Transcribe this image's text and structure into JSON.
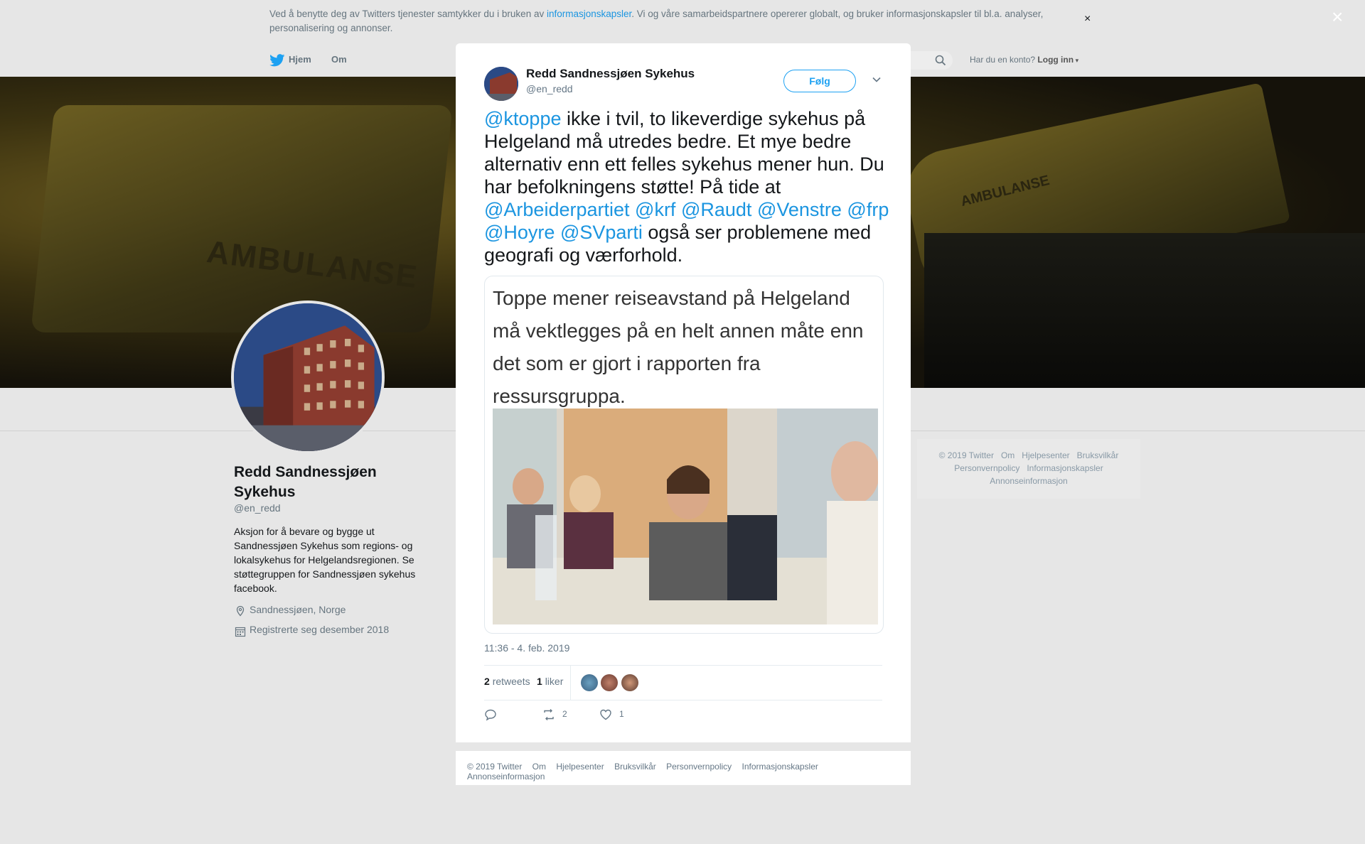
{
  "cookie": {
    "text_before": "Ved å benytte deg av Twitters tjenester samtykker du i bruken av ",
    "link": "informasjonskapsler",
    "text_after": ". Vi og våre samarbeidspartnere opererer globalt, og bruker informasjonskapsler til bl.a. analyser, personalisering og annonser.",
    "close": "×"
  },
  "nav": {
    "home": "Hjem",
    "about": "Om",
    "account_prompt": "Har du en konto?",
    "login": "Logg inn"
  },
  "profile": {
    "name": "Redd Sandnessjøen Sykehus",
    "handle": "@en_redd",
    "bio": "Aksjon for å bevare og bygge ut Sandnessjøen Sykehus som regions- og lokalsykehus for Helgelandsregionen. Se støttegruppen for Sandnessjøen sykehus facebook.",
    "location": "Sandnessjøen, Norge",
    "joined": "Registrerte seg desember 2018"
  },
  "banner": {
    "text_left": "AMBULANSE",
    "text_right": "AMBULANSE"
  },
  "side_footer": {
    "row1": [
      "© 2019 Twitter",
      "Om",
      "Hjelpesenter",
      "Bruksvilkår"
    ],
    "row2": [
      "Personvernpolicy",
      "Informasjonskapsler"
    ],
    "row3": [
      "Annonseinformasjon"
    ]
  },
  "overlay_close": "×",
  "tweet": {
    "author_name": "Redd Sandnessjøen Sykehus",
    "author_handle": "@en_redd",
    "follow_label": "Følg",
    "mention1": "@ktoppe",
    "text_part1": " ikke i tvil, to likeverdige sykehus på Helgeland må utredes bedre. Et mye bedre alternativ enn ett felles sykehus mener hun. Du har befolkningens støtte! På tide at ",
    "mentions": [
      "@Arbeiderpartiet",
      "@krf",
      "@Raudt",
      "@Venstre",
      "@frp",
      "@Hoyre",
      "@SVparti"
    ],
    "text_part2": " også ser problemene med geografi og værforhold.",
    "media_caption": "Toppe mener reiseavstand på Helgeland må vektlegges på en helt annen måte enn det som er gjort i rapporten fra ressursgruppa.",
    "timestamp": "11:36 - 4. feb. 2019",
    "retweets_count": "2",
    "retweets_label": "retweets",
    "likes_count": "1",
    "likes_label": "liker",
    "action_retweets": "2",
    "action_likes": "1"
  },
  "modal_footer": [
    "© 2019 Twitter",
    "Om",
    "Hjelpesenter",
    "Bruksvilkår",
    "Personvernpolicy",
    "Informasjonskapsler",
    "Annonseinformasjon"
  ],
  "colors": {
    "link": "#1b95e0",
    "follow": "#1da1f2",
    "background": "#e6e6e6"
  }
}
